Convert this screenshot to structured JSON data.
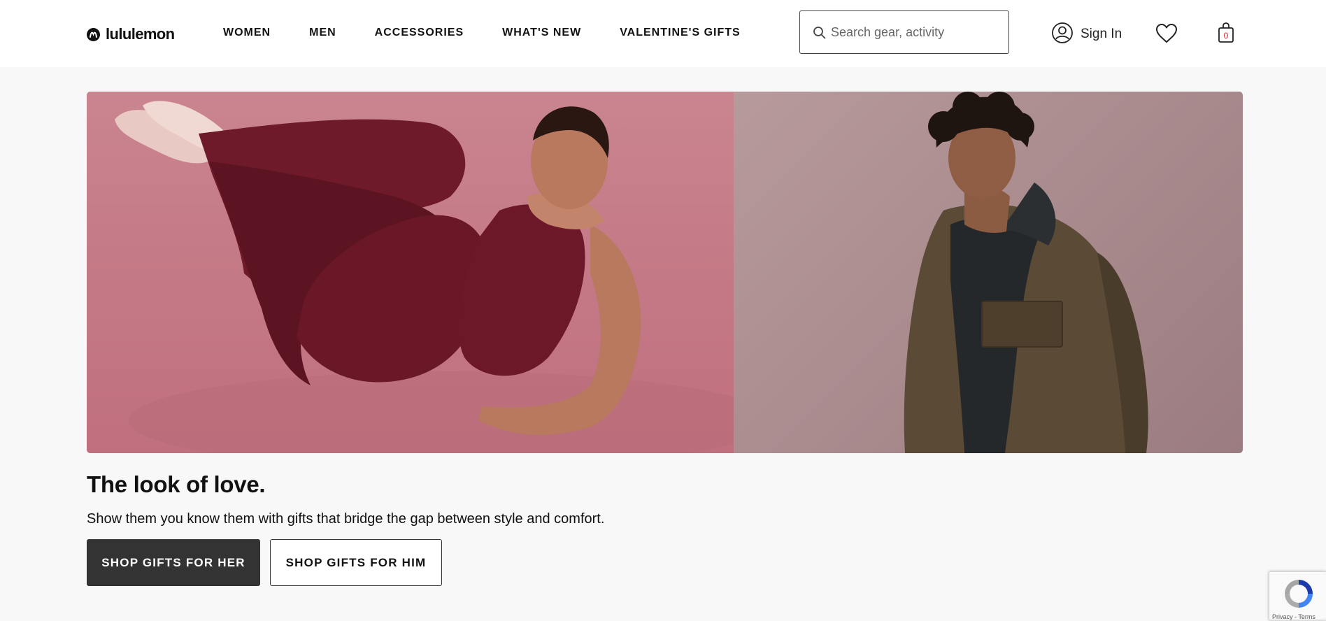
{
  "header": {
    "logo_text": "lululemon",
    "nav": [
      "WOMEN",
      "MEN",
      "ACCESSORIES",
      "WHAT'S NEW",
      "VALENTINE'S GIFTS"
    ],
    "search": {
      "placeholder": "Search gear, activity"
    },
    "sign_in_label": "Sign In",
    "bag_count": "0"
  },
  "hero": {
    "left_panel": "woman-in-burgundy-outfit",
    "right_panel": "man-in-olive-jacket"
  },
  "promo": {
    "headline": "The look of love.",
    "subtext": "Show them you know them with gifts that bridge the gap between style and comfort.",
    "cta_her": "SHOP GIFTS FOR HER",
    "cta_him": "SHOP GIFTS FOR HIM"
  },
  "recaptcha": {
    "footer_text": "Privacy - Terms"
  },
  "colors": {
    "page_bg": "#f8f8f8",
    "header_bg": "#ffffff",
    "primary_button": "#333333",
    "bag_count": "#d22030"
  }
}
